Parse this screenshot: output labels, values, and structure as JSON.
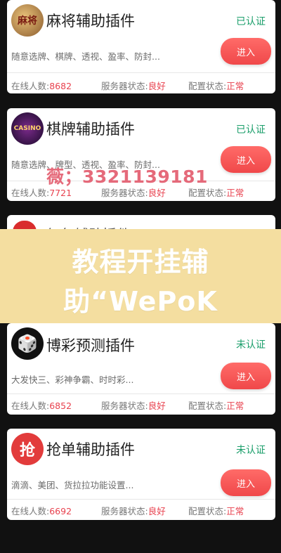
{
  "cards": [
    {
      "name": "麻将辅助插件",
      "status": "已认证",
      "desc": "随意选牌、棋牌、透视、盈率、防封...",
      "button": "进入",
      "online_label": "在线人数:",
      "online_value": "8682",
      "server_label": "服务器状态:",
      "server_value": "良好",
      "config_label": "配置状态:",
      "config_value": "正常",
      "icon_text": "麻将"
    },
    {
      "name": "棋牌辅助插件",
      "status": "已认证",
      "desc": "随意选牌、牌型、透视、盈率、防封...",
      "button": "进入",
      "online_label": "在线人数:",
      "online_value": "7721",
      "server_label": "服务器状态:",
      "server_value": "良好",
      "config_label": "配置状态:",
      "config_value": "正常",
      "icon_text": "CASINO"
    },
    {
      "name": "博彩预测插件",
      "status": "未认证",
      "desc": "大发快三、彩神争霸、时时彩...",
      "button": "进入",
      "online_label": "在线人数:",
      "online_value": "6852",
      "server_label": "服务器状态:",
      "server_value": "良好",
      "config_label": "配置状态:",
      "config_value": "正常",
      "icon_text": "🎲"
    },
    {
      "name": "抢单辅助插件",
      "status": "未认证",
      "desc": "滴滴、美团、货拉拉功能设置...",
      "button": "进入",
      "online_label": "在线人数:",
      "online_value": "6692",
      "server_label": "服务器状态:",
      "server_value": "良好",
      "config_label": "配置状态:",
      "config_value": "正常",
      "icon_text": "抢"
    }
  ],
  "partial_card_title": "红包辅助插件",
  "watermark": "薇；3321139181",
  "banner": {
    "line1": "教程开挂辅",
    "line2": "助“WePoK"
  },
  "colors": {
    "status_green": "#1a9e6a",
    "button_red": "#f0484a",
    "value_red": "#e8414e",
    "banner_bg": "#f4dea0"
  }
}
